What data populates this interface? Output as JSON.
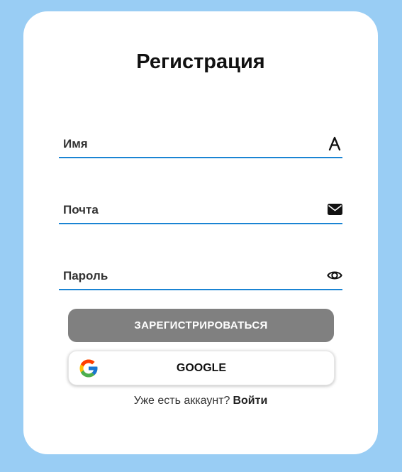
{
  "form": {
    "title": "Регистрация",
    "fields": [
      {
        "label": "Имя",
        "icon": "user-letter-icon"
      },
      {
        "label": "Почта",
        "icon": "envelope-icon"
      },
      {
        "label": "Пароль",
        "icon": "eye-icon"
      }
    ],
    "register_button": "ЗАРЕГИСТРИРОВАТЬСЯ",
    "google_button": "GOOGLE",
    "login_prompt": "Уже есть аккаунт?",
    "login_link": "Войти"
  },
  "colors": {
    "background": "#99cdf4",
    "card": "#ffffff",
    "underline": "#1a84d3",
    "register_button": "#808080"
  }
}
